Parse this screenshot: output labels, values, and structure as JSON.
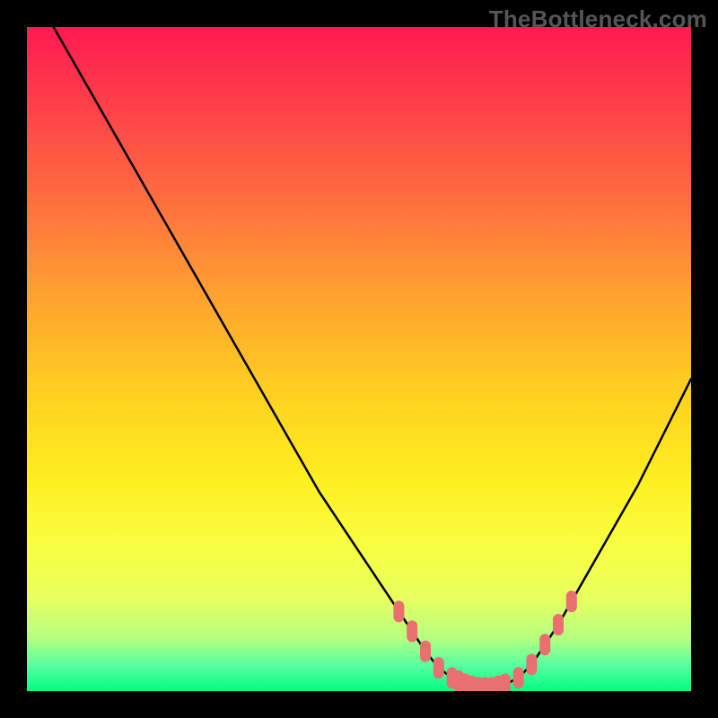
{
  "watermark": "TheBottleneck.com",
  "chart_data": {
    "type": "line",
    "title": "",
    "xlabel": "",
    "ylabel": "",
    "xlim": [
      0,
      100
    ],
    "ylim": [
      0,
      100
    ],
    "series": [
      {
        "name": "bottleneck-curve",
        "x": [
          4,
          8,
          12,
          16,
          20,
          24,
          28,
          32,
          36,
          40,
          44,
          48,
          52,
          56,
          58,
          60,
          62,
          64,
          66,
          68,
          70,
          72,
          74,
          76,
          78,
          80,
          84,
          88,
          92,
          96,
          100
        ],
        "values": [
          100,
          93,
          86,
          79,
          72,
          65,
          58,
          51,
          44,
          37,
          30,
          24,
          18,
          12,
          9,
          6,
          3.5,
          2,
          1,
          0.5,
          0.5,
          1,
          2,
          4,
          7,
          10,
          17,
          24,
          31,
          39,
          47
        ]
      }
    ],
    "highlight": {
      "name": "target-zone-dots",
      "x": [
        56,
        58,
        60,
        62,
        64,
        65,
        66,
        67,
        68,
        69,
        70,
        71,
        72,
        74,
        76,
        78,
        80,
        82
      ],
      "values": [
        12,
        9,
        6,
        3.5,
        2,
        1.5,
        1,
        0.7,
        0.5,
        0.5,
        0.5,
        0.7,
        1,
        2,
        4,
        7,
        10,
        13.5
      ],
      "color": "#e87070"
    }
  },
  "colors": {
    "curve": "#000000",
    "dots": "#e87070",
    "background_top": "#ff1a52",
    "background_bottom": "#00ff80"
  }
}
